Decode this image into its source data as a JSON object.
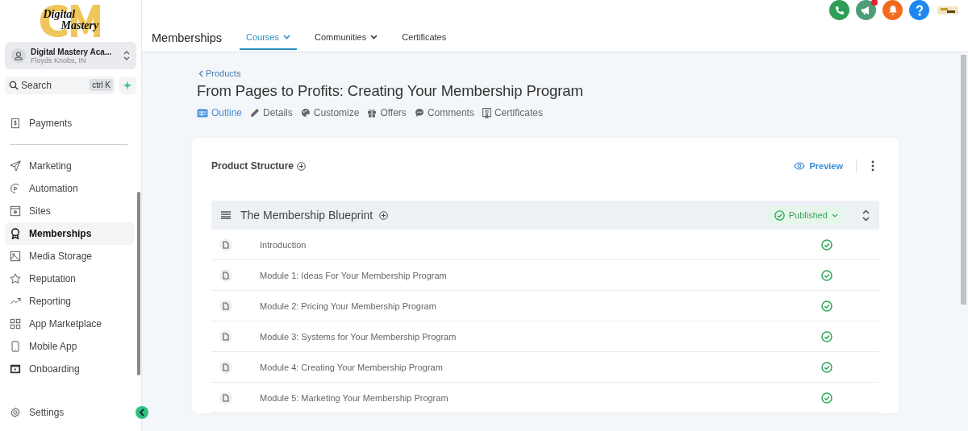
{
  "logo": {
    "line_1": "Digital",
    "line_2": "Mastery"
  },
  "account": {
    "name": "Digital Mastery Aca...",
    "location": "Floyds Knobs, IN"
  },
  "search": {
    "placeholder": "Search",
    "shortcut": "ctrl K"
  },
  "sidebar": {
    "items": [
      {
        "label": "Payments",
        "selected": false,
        "divider_after": true
      },
      {
        "label": "Marketing",
        "selected": false,
        "divider_after": false
      },
      {
        "label": "Automation",
        "selected": false,
        "divider_after": false
      },
      {
        "label": "Sites",
        "selected": false,
        "divider_after": false
      },
      {
        "label": "Memberships",
        "selected": true,
        "divider_after": false
      },
      {
        "label": "Media Storage",
        "selected": false,
        "divider_after": false
      },
      {
        "label": "Reputation",
        "selected": false,
        "divider_after": false
      },
      {
        "label": "Reporting",
        "selected": false,
        "divider_after": false
      },
      {
        "label": "App Marketplace",
        "selected": false,
        "divider_after": false
      },
      {
        "label": "Mobile App",
        "selected": false,
        "divider_after": false
      },
      {
        "label": "Onboarding",
        "selected": false,
        "divider_after": false
      }
    ],
    "settings": "Settings"
  },
  "header": {
    "title": "Memberships",
    "tabs": [
      {
        "label": "Courses",
        "selected": true,
        "has_menu": true
      },
      {
        "label": "Communities",
        "selected": false,
        "has_menu": true
      },
      {
        "label": "Certificates",
        "selected": false,
        "has_menu": false
      }
    ],
    "announcements_unread": true
  },
  "breadcrumb": "Products",
  "product": {
    "title": "From Pages to Profits: Creating Your Membership Program",
    "tabs": [
      {
        "label": "Outline",
        "selected": true
      },
      {
        "label": "Details",
        "selected": false
      },
      {
        "label": "Customize",
        "selected": false
      },
      {
        "label": "Offers",
        "selected": false
      },
      {
        "label": "Comments",
        "selected": false
      },
      {
        "label": "Certificates",
        "selected": false
      }
    ]
  },
  "structure": {
    "title": "Product Structure",
    "preview": "Preview",
    "category": {
      "title": "The Membership Blueprint",
      "status": "Published",
      "lessons": [
        {
          "title": "Introduction",
          "published": true
        },
        {
          "title": "Module 1: Ideas For Your Membership Program",
          "published": true
        },
        {
          "title": "Module 2: Pricing Your Membership Program",
          "published": true
        },
        {
          "title": "Module 3: Systems for Your Membership Program",
          "published": true
        },
        {
          "title": "Module 4: Creating Your Membership Program",
          "published": true
        },
        {
          "title": "Module 5: Marketing Your Membership Program",
          "published": true
        }
      ]
    }
  }
}
